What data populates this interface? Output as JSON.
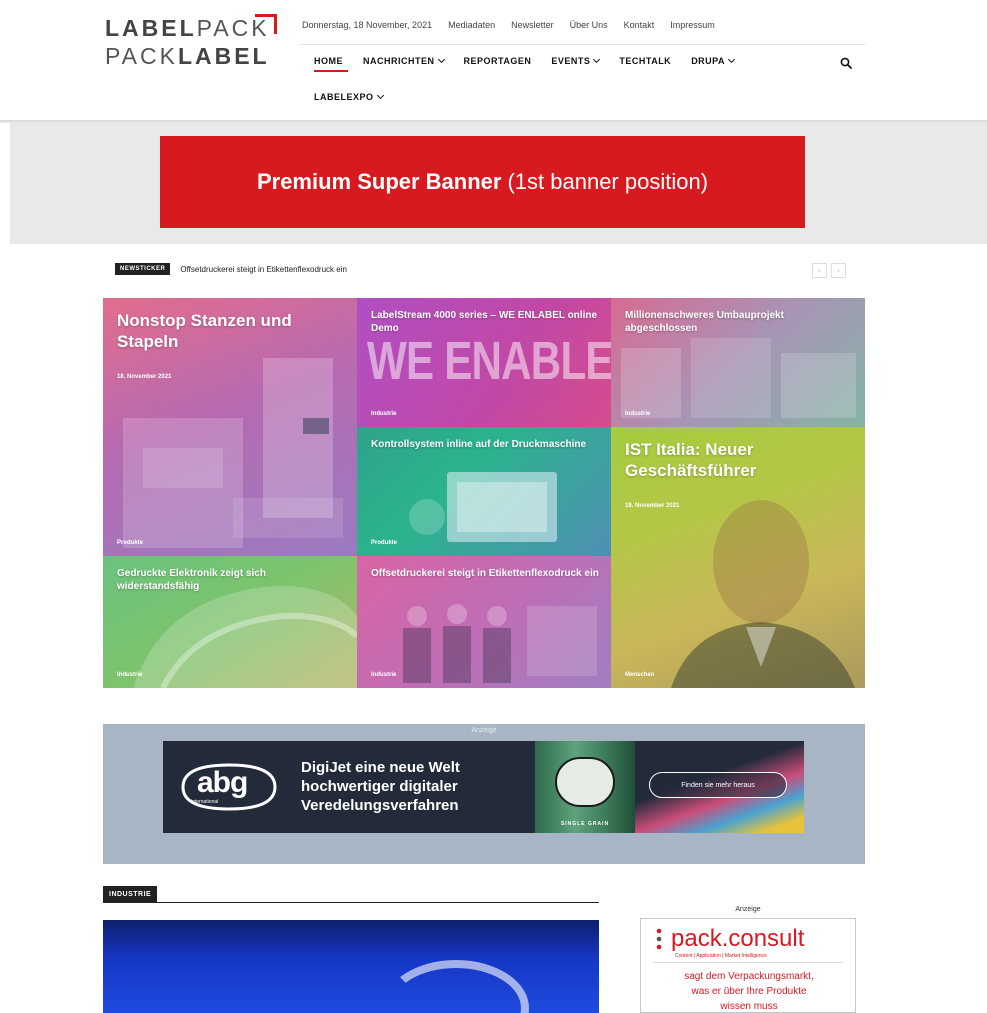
{
  "brand": {
    "logo_line1_bold": "LABEL",
    "logo_line1_rest": "PACK",
    "logo_line2_rest": "PACK",
    "logo_line2_bold": "LABEL",
    "accent": "#d71920"
  },
  "topbar": {
    "date": "Donnerstag, 18 November, 2021",
    "links": [
      "Mediadaten",
      "Newsletter",
      "Über Uns",
      "Kontakt",
      "Impressum"
    ]
  },
  "nav": {
    "items": [
      {
        "label": "HOME",
        "dropdown": false
      },
      {
        "label": "NACHRICHTEN",
        "dropdown": true
      },
      {
        "label": "REPORTAGEN",
        "dropdown": false
      },
      {
        "label": "EVENTS",
        "dropdown": true
      },
      {
        "label": "TECHTALK",
        "dropdown": false
      },
      {
        "label": "DRUPA",
        "dropdown": true
      },
      {
        "label": "LABELEXPO",
        "dropdown": true
      }
    ],
    "search_icon": "search-icon"
  },
  "banner": {
    "bold": "Premium Super Banner",
    "rest": "(1st banner position)"
  },
  "ticker": {
    "badge": "NEWSTICKER",
    "headline": "Offsetdruckerei steigt in Etikettenflexodruck ein",
    "prev": "‹",
    "next": "›"
  },
  "tiles": [
    {
      "title": "Nonstop Stanzen und Stapeln",
      "date": "18. November 2021",
      "category": "Produkte"
    },
    {
      "title": "LabelStream 4000 series – WE ENLABEL online Demo",
      "overlay": "WE ENABLE",
      "category": "Industrie"
    },
    {
      "title": "Millionenschweres Umbauprojekt abgeschlossen",
      "category": "Industrie"
    },
    {
      "title": "Kontrollsystem inline auf der Druckmaschine",
      "category": "Produkte"
    },
    {
      "title": "IST Italia: Neuer Geschäftsführer",
      "date": "18. November 2021",
      "category": "Menschen"
    },
    {
      "title": "Gedruckte Elektronik zeigt sich widerstandsfähig",
      "category": "Industrie"
    },
    {
      "title": "Offsetdruckerei steigt in Etikettenflexodruck ein",
      "category": "Industrie"
    }
  ],
  "ad_abg": {
    "label": "Anzeige",
    "logo": "abg",
    "logo_sub": "international",
    "headline": [
      "DigiJet eine neue Welt",
      "hochwertiger digitaler",
      "Veredelungsverfahren"
    ],
    "bottle_text": "SINGLE GRAIN",
    "cta": "Finden sie mehr heraus"
  },
  "industrie": {
    "badge": "INDUSTRIE"
  },
  "side_ad": {
    "label": "Anzeige",
    "logo": "pack.consult",
    "tagline": "Content | Application | Market Intelligence",
    "copy": [
      "sagt dem Verpackungsmarkt,",
      "was er über Ihre Produkte",
      "wissen muss"
    ]
  }
}
